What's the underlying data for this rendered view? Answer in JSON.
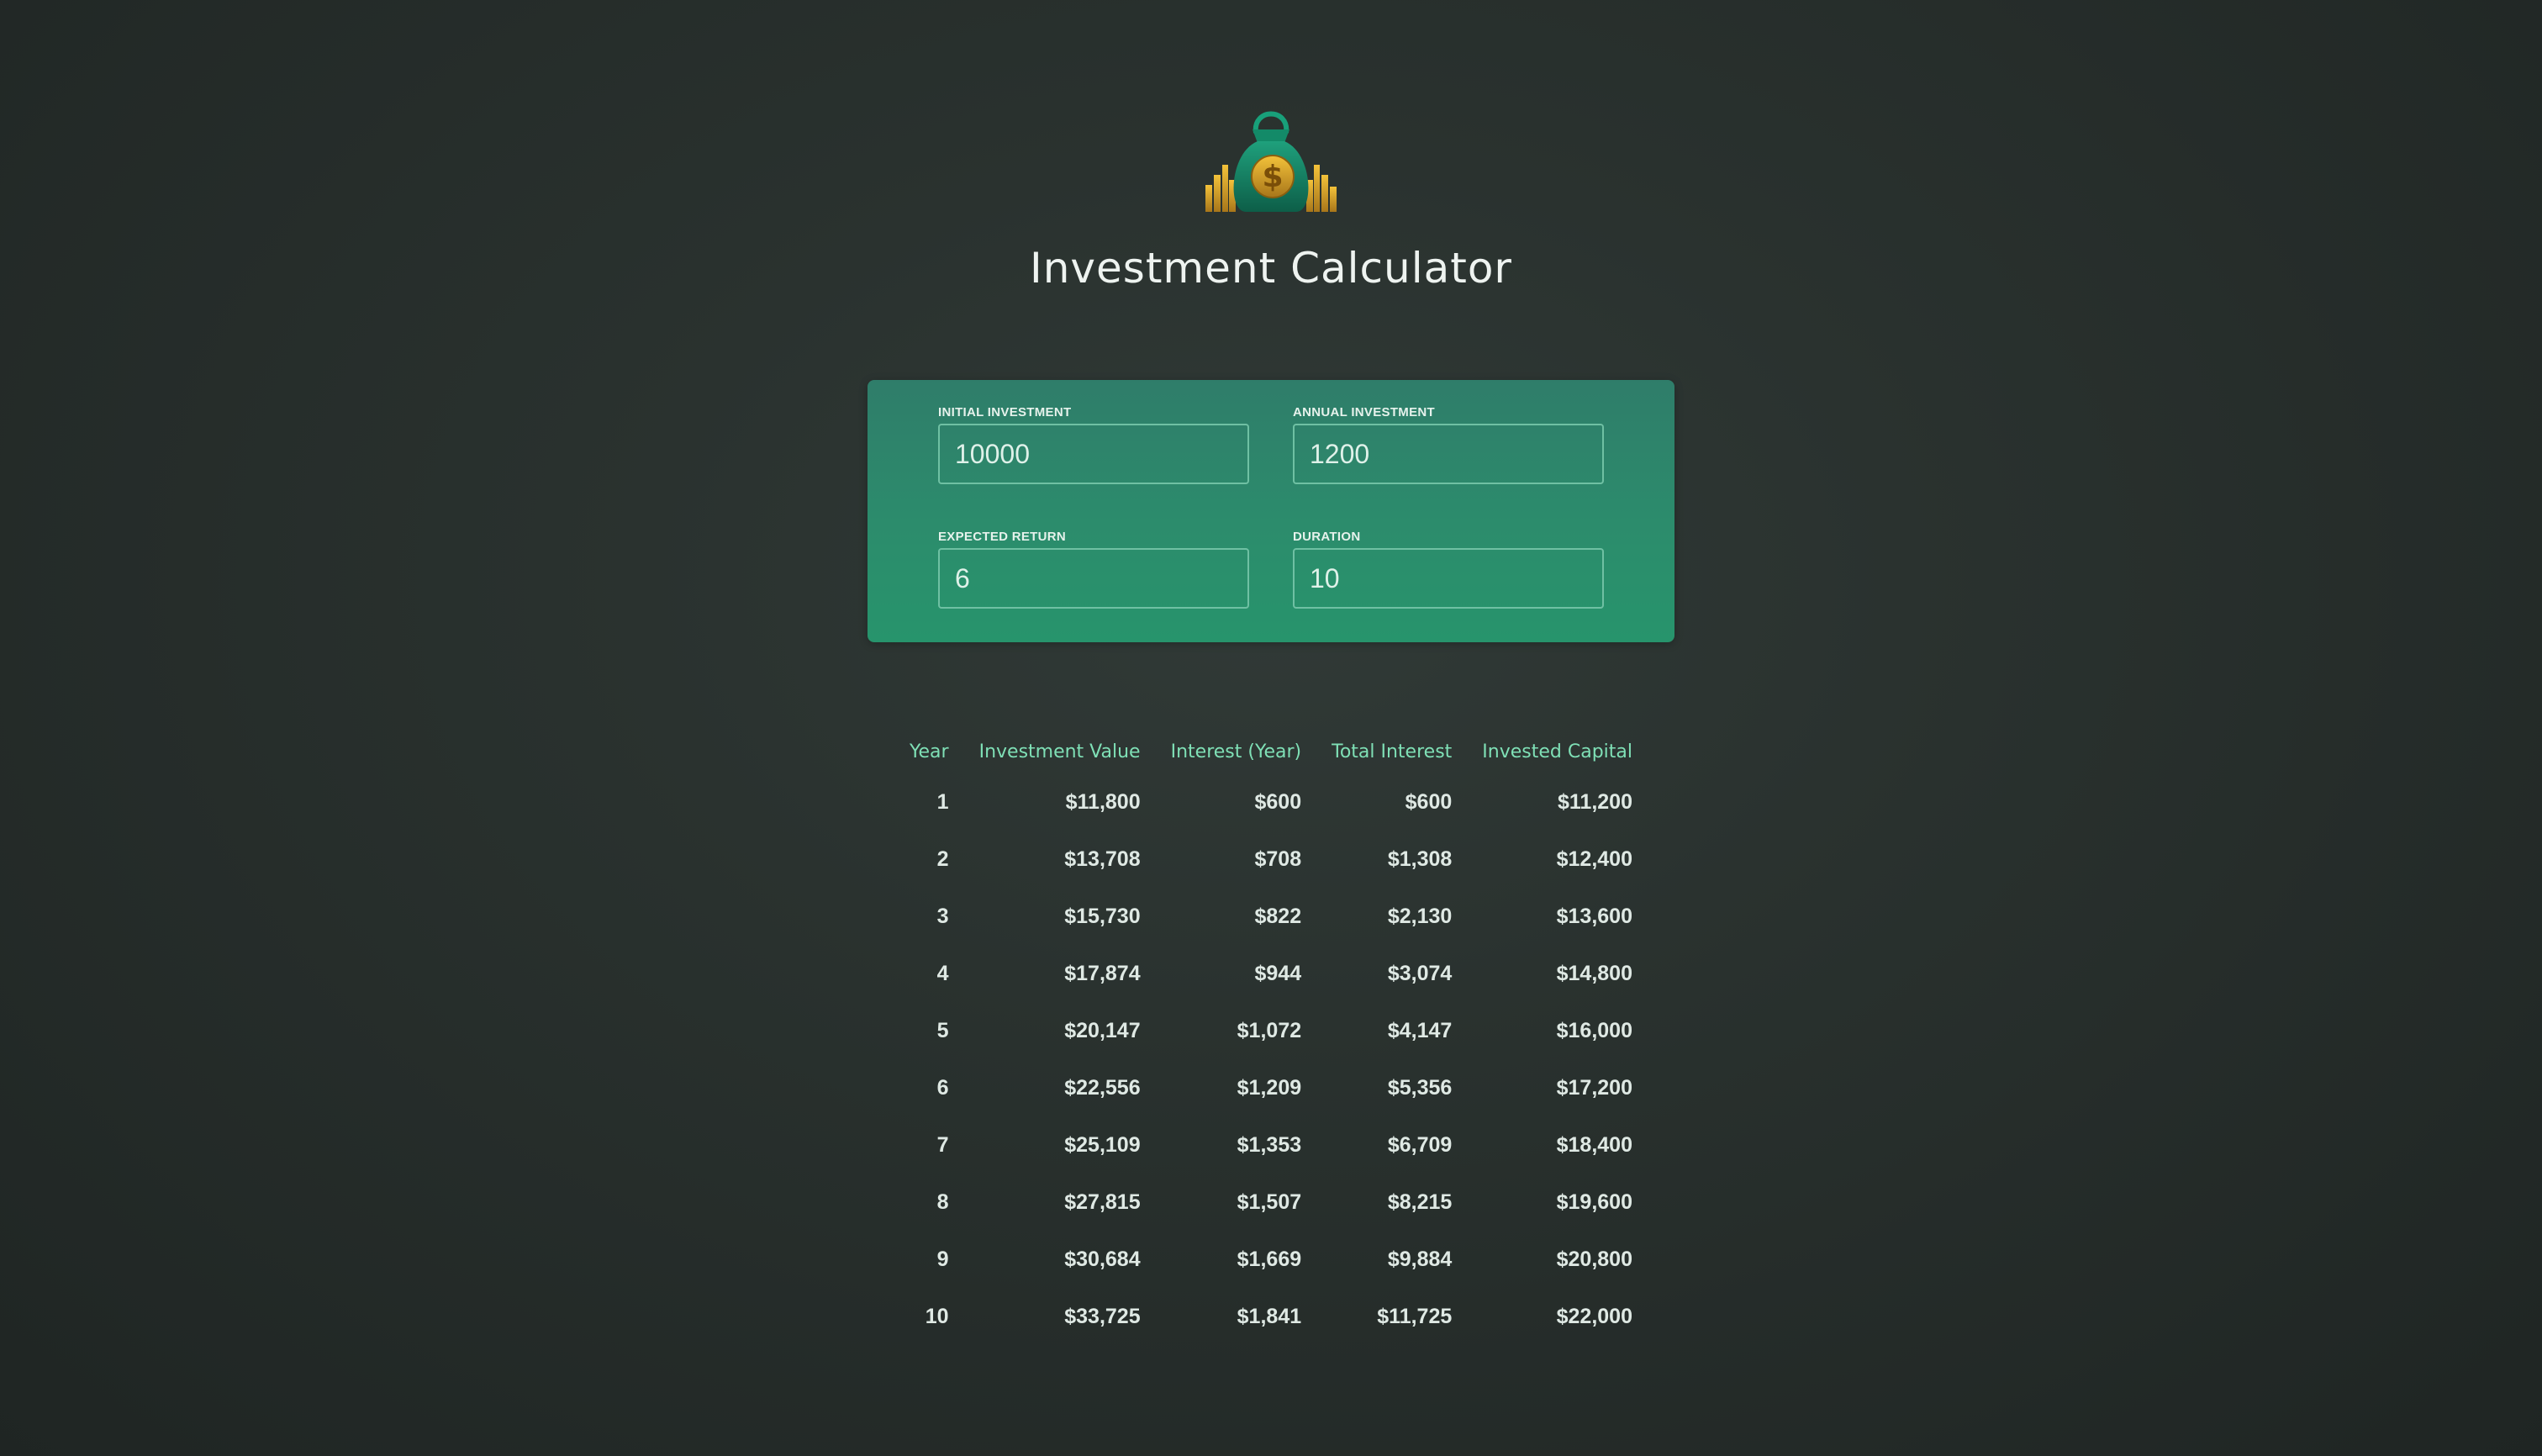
{
  "header": {
    "title": "Investment Calculator",
    "logo_icon": "money-bag-icon"
  },
  "inputs": {
    "initial_investment": {
      "label": "Initial Investment",
      "value": "10000"
    },
    "annual_investment": {
      "label": "Annual Investment",
      "value": "1200"
    },
    "expected_return": {
      "label": "Expected Return",
      "value": "6"
    },
    "duration": {
      "label": "Duration",
      "value": "10"
    }
  },
  "table": {
    "columns": [
      "Year",
      "Investment Value",
      "Interest (Year)",
      "Total Interest",
      "Invested Capital"
    ],
    "rows": [
      [
        "1",
        "$11,800",
        "$600",
        "$600",
        "$11,200"
      ],
      [
        "2",
        "$13,708",
        "$708",
        "$1,308",
        "$12,400"
      ],
      [
        "3",
        "$15,730",
        "$822",
        "$2,130",
        "$13,600"
      ],
      [
        "4",
        "$17,874",
        "$944",
        "$3,074",
        "$14,800"
      ],
      [
        "5",
        "$20,147",
        "$1,072",
        "$4,147",
        "$16,000"
      ],
      [
        "6",
        "$22,556",
        "$1,209",
        "$5,356",
        "$17,200"
      ],
      [
        "7",
        "$25,109",
        "$1,353",
        "$6,709",
        "$18,400"
      ],
      [
        "8",
        "$27,815",
        "$1,507",
        "$8,215",
        "$19,600"
      ],
      [
        "9",
        "$30,684",
        "$1,669",
        "$9,884",
        "$20,800"
      ],
      [
        "10",
        "$33,725",
        "$1,841",
        "$11,725",
        "$22,000"
      ]
    ]
  },
  "colors": {
    "accent": "#7fe0b6",
    "panel": "#2c8c6c",
    "background": "#2a322f"
  }
}
